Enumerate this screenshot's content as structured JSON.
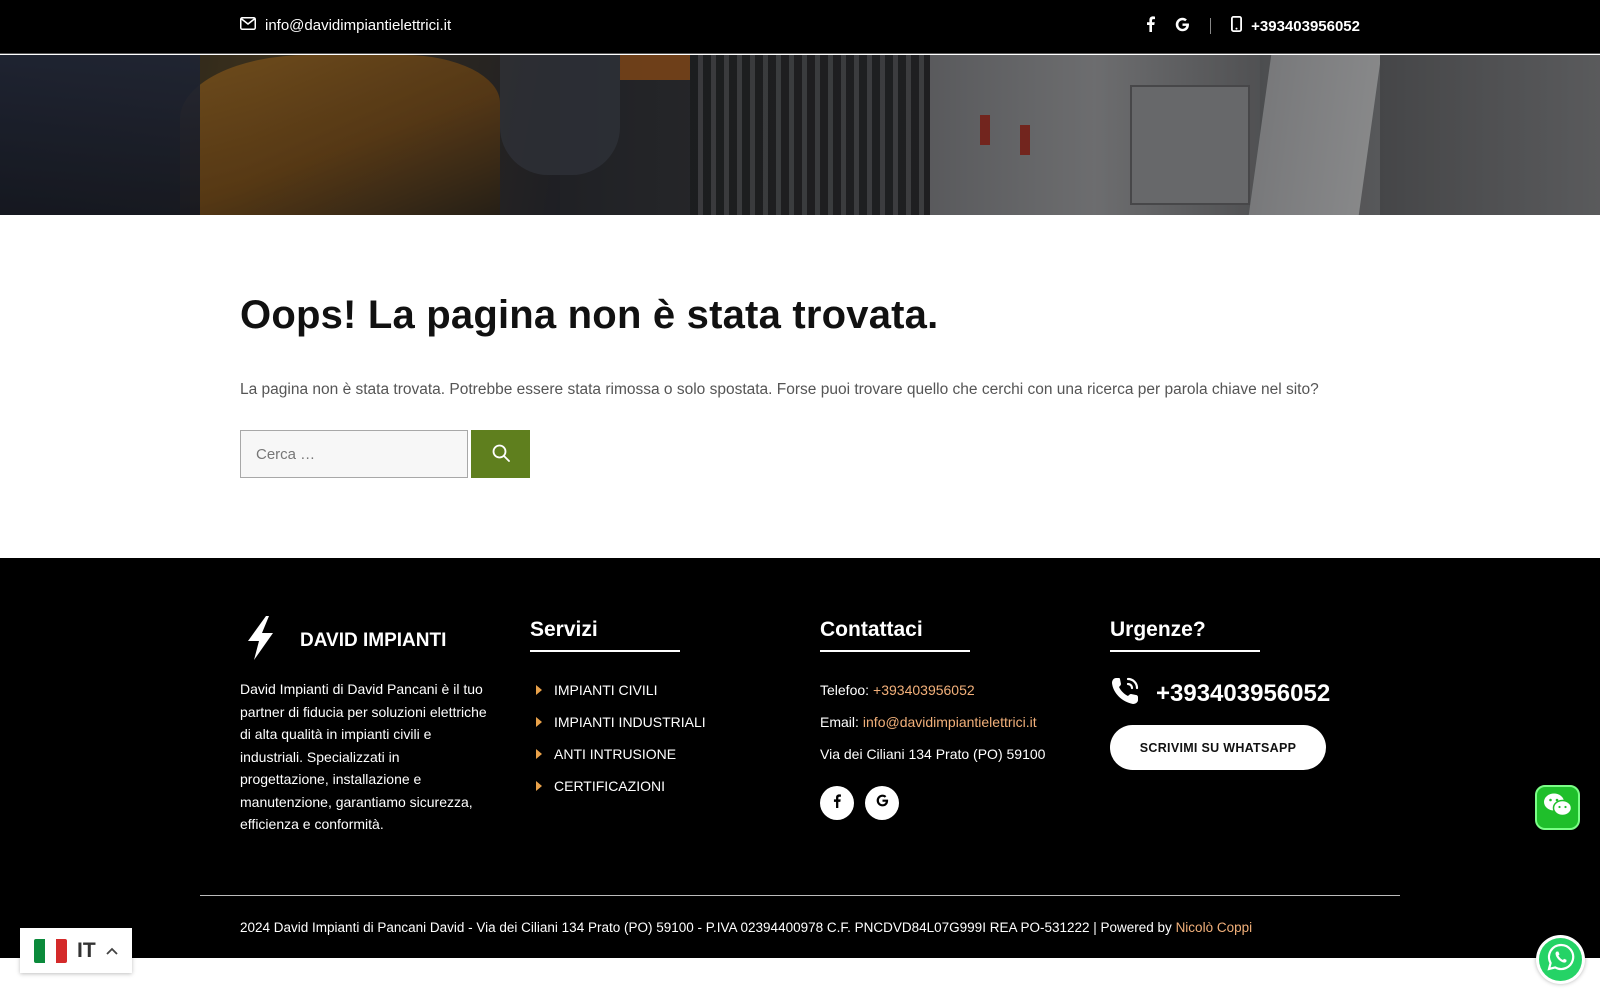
{
  "topbar": {
    "email": "info@davidimpiantielettrici.it",
    "phone": "+393403956052",
    "social_icons": [
      "facebook-icon",
      "google-icon"
    ]
  },
  "main": {
    "title": "Oops! La pagina non è stata trovata.",
    "description": "La pagina non è stata trovata. Potrebbe essere stata rimossa o solo spostata. Forse puoi trovare quello che cerchi con una ricerca per parola chiave nel sito?",
    "search": {
      "placeholder": "Cerca …",
      "value": ""
    }
  },
  "footer": {
    "brand": {
      "name": "DAVID IMPIANTI",
      "description": "David Impianti di David Pancani è il tuo partner di fiducia per soluzioni elettriche di alta qualità in impianti civili e industriali. Specializzati in progettazione, installazione e manutenzione, garantiamo sicurezza, efficienza e conformità."
    },
    "servizi": {
      "title": "Servizi",
      "items": [
        "IMPIANTI CIVILI",
        "IMPIANTI INDUSTRIALI",
        "ANTI INTRUSIONE",
        "CERTIFICAZIONI"
      ]
    },
    "contatti": {
      "title": "Contattaci",
      "phone_label": "Telefoo:",
      "phone_value": "+393403956052",
      "email_label": "Email:",
      "email_value": "info@davidimpiantielettrici.it",
      "address": "Via dei Ciliani 134 Prato (PO) 59100"
    },
    "urgenze": {
      "title": "Urgenze?",
      "phone": "+393403956052",
      "whatsapp_button": "SCRIVIMI SU WHATSAPP"
    },
    "copyright": {
      "text": "2024 David Impianti di Pancani David - Via dei Ciliani 134 Prato (PO) 59100 - P.IVA 02394400978 C.F. PNCDVD84L07G999I REA PO-531222 | Powered by ",
      "author": "Nicolò Coppi"
    }
  },
  "language": {
    "code": "IT"
  },
  "colors": {
    "accent_green": "#5f7f1e",
    "accent_orange": "#f2b07a",
    "whatsapp_green": "#25d366",
    "wechat_green": "#1fbf2b"
  }
}
